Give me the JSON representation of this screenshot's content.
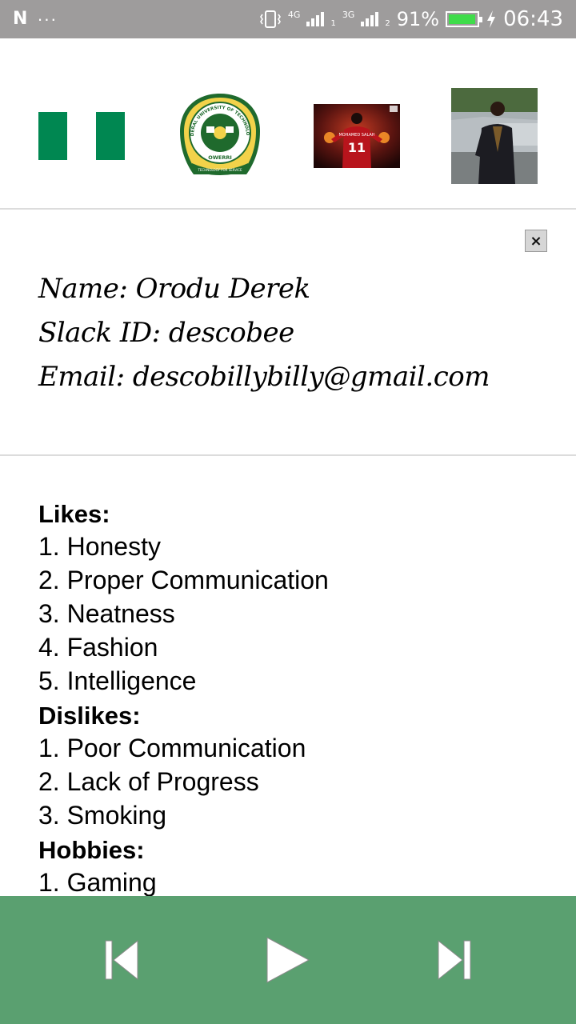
{
  "status_bar": {
    "network_1": "4G",
    "sim_1": "1",
    "network_2": "3G",
    "sim_2": "2",
    "battery": "91%",
    "time": "06:43"
  },
  "profile": {
    "name": "Name: Orodu Derek",
    "slack": "Slack ID: descobee",
    "email": "Email: descobillybilly@gmail.com"
  },
  "likes": {
    "title": "Likes:",
    "items": [
      "1. Honesty",
      "2. Proper Communication",
      "3. Neatness",
      "4. Fashion",
      "5. Intelligence"
    ]
  },
  "dislikes": {
    "title": "Dislikes:",
    "items": [
      "1. Poor Communication",
      "2. Lack of Progress",
      "3. Smoking"
    ]
  },
  "hobbies": {
    "title": "Hobbies:",
    "items": [
      "1. Gaming"
    ]
  },
  "logo_text": {
    "top": "FEDERAL UNIVERSITY OF TECHNOLOGY",
    "bottom": "OWERRI",
    "motto": "TECHNOLOGY FOR SERVICE"
  },
  "poster_text": {
    "name": "MOHAMED SALAH",
    "number": "11"
  },
  "colors": {
    "status_bar": "#9e9c9c",
    "player_bar": "#5aa070",
    "flag_green": "#008751",
    "battery_fill": "#3fdc4a"
  },
  "icons": {
    "close": "×",
    "previous": "skip-previous-icon",
    "play": "play-icon",
    "next": "skip-next-icon"
  }
}
